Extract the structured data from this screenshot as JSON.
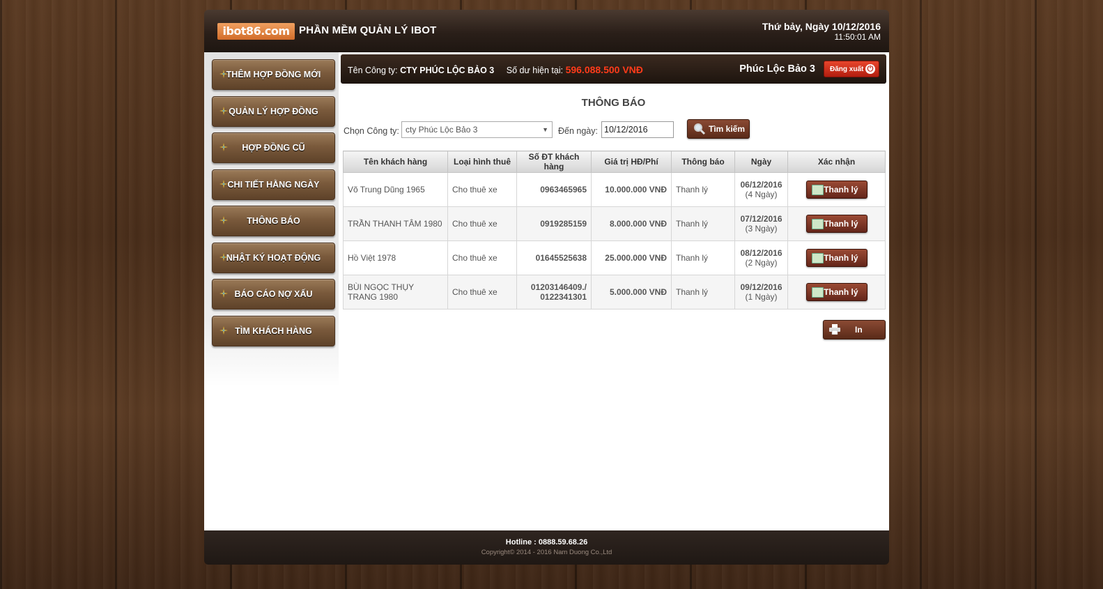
{
  "header": {
    "logo_text": "ibot86.com",
    "app_title": "PHẦN MỀM QUẢN LÝ IBOT",
    "date": "Thứ bảy, Ngày 10/12/2016",
    "time": "11:50:01 AM"
  },
  "sidebar": {
    "items": [
      {
        "label": "THÊM HỢP ĐỒNG MỚI",
        "icon": "star-icon"
      },
      {
        "label": "QUẢN LÝ HỢP ĐỒNG",
        "icon": "star-icon"
      },
      {
        "label": "HỢP ĐỒNG CŨ",
        "icon": "star-icon"
      },
      {
        "label": "CHI TIẾT HẰNG NGÀY",
        "icon": "star-icon"
      },
      {
        "label": "THÔNG BÁO",
        "icon": "star-icon"
      },
      {
        "label": "NHẬT KÝ HOẠT ĐỘNG",
        "icon": "star-icon"
      },
      {
        "label": "BÁO CÁO NỢ XẤU",
        "icon": "star-icon"
      },
      {
        "label": "TÌM KHÁCH HÀNG",
        "icon": "star-icon"
      }
    ]
  },
  "topbar": {
    "company_label": "Tên Công ty:",
    "company_name": "CTY PHÚC LỘC BẢO 3",
    "balance_label": "Số dư hiện tại:",
    "balance_value": "596.088.500 VNĐ",
    "user_name": "Phúc Lộc Bảo 3",
    "logout_label": "Đăng xuất",
    "balance_color": "#ff3b1a"
  },
  "page": {
    "heading": "THÔNG BÁO"
  },
  "filters": {
    "company_label": "Chọn Công ty:",
    "company_selected": "cty Phúc Lộc Bảo 3",
    "date_label": "Đến ngày:",
    "date_value": "10/12/2016",
    "search_label": "Tìm kiếm"
  },
  "table": {
    "columns": [
      "Tên khách hàng",
      "Loại hình thuê",
      "Số ĐT khách hàng",
      "Giá trị HĐ/Phí",
      "Thông báo",
      "Ngày",
      "Xác nhận"
    ],
    "rows": [
      {
        "name": "Võ Trung Dũng 1965",
        "type": "Cho thuê xe",
        "phone": "0963465965",
        "value": "10.000.000 VNĐ",
        "notice": "Thanh lý",
        "date": "06/12/2016",
        "days": "(4 Ngày)",
        "action": "Thanh lý"
      },
      {
        "name": "TRẦN THANH TÂM 1980",
        "type": "Cho thuê xe",
        "phone": "0919285159",
        "value": "8.000.000 VNĐ",
        "notice": "Thanh lý",
        "date": "07/12/2016",
        "days": "(3 Ngày)",
        "action": "Thanh lý"
      },
      {
        "name": "Hồ Việt 1978",
        "type": "Cho thuê xe",
        "phone": "01645525638",
        "value": "25.000.000 VNĐ",
        "notice": "Thanh lý",
        "date": "08/12/2016",
        "days": "(2 Ngày)",
        "action": "Thanh lý"
      },
      {
        "name": "BÙI NGỌC THỤY TRANG 1980",
        "type": "Cho thuê xe",
        "phone": "01203146409./ 0122341301",
        "value": "5.000.000 VNĐ",
        "notice": "Thanh lý",
        "date": "09/12/2016",
        "days": "(1 Ngày)",
        "action": "Thanh lý"
      }
    ]
  },
  "print_label": "In",
  "footer": {
    "hotline": "Hotline : 0888.59.68.26",
    "copyright": "Copyright© 2014 - 2016 Nam Duong Co.,Ltd"
  }
}
